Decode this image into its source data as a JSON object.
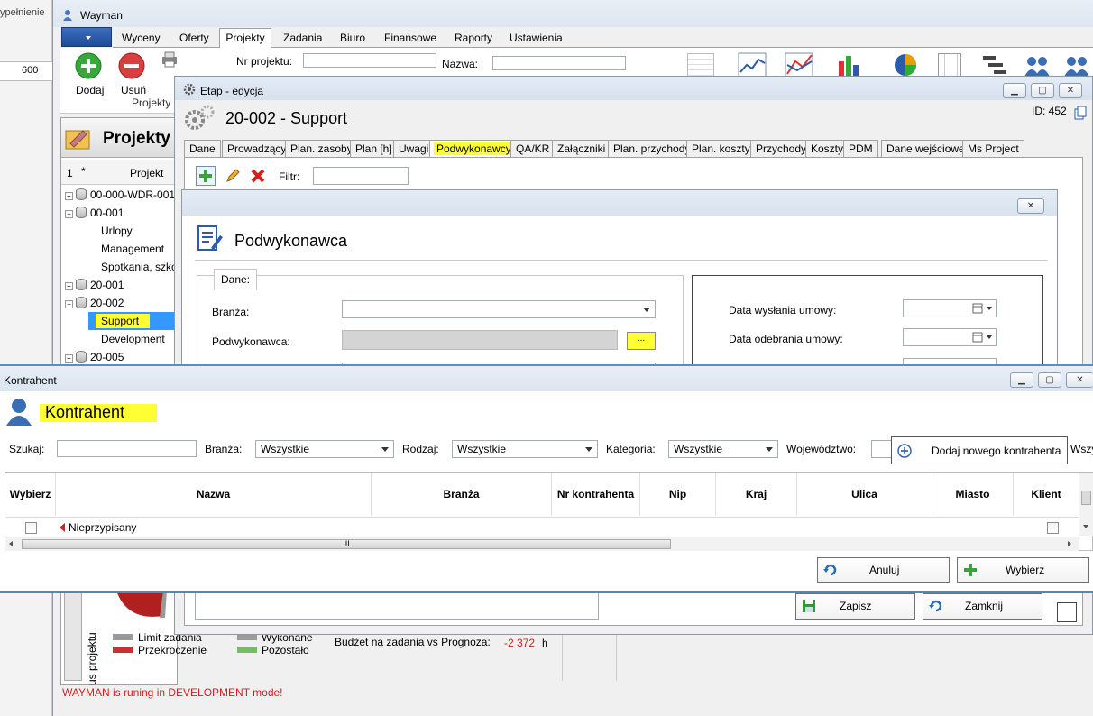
{
  "background_app": {
    "left_strip_text": "ypełnienie",
    "ruler_value": "600"
  },
  "main_window": {
    "title": "Wayman",
    "menu_tabs": [
      "Wyceny",
      "Oferty",
      "Projekty",
      "Zadania",
      "Biuro",
      "Finansowe",
      "Raporty",
      "Ustawienia"
    ],
    "active_tab": "Projekty",
    "ribbon": {
      "add_label": "Dodaj",
      "remove_label": "Usuń",
      "group_label": "Projekty",
      "project_number_label": "Nr projektu:",
      "name_label": "Nazwa:"
    },
    "panel_title": "Projekty",
    "tree_header": {
      "col1": "1",
      "col2": "*",
      "col3": "Projekt"
    },
    "tree_items": [
      {
        "label": "00-000-WDR-001",
        "level": 0,
        "expander": "+"
      },
      {
        "label": "00-001",
        "level": 0,
        "expander": "−"
      },
      {
        "label": "Urlopy",
        "level": 1
      },
      {
        "label": "Management",
        "level": 1
      },
      {
        "label": "Spotkania, szkol",
        "level": 1
      },
      {
        "label": "20-001",
        "level": 0,
        "expander": "+"
      },
      {
        "label": "20-002",
        "level": 0,
        "expander": "−"
      },
      {
        "label": "Support",
        "level": 1,
        "selected": true
      },
      {
        "label": "Development",
        "level": 1
      },
      {
        "label": "20-005",
        "level": 0,
        "expander": "+"
      }
    ],
    "side_vertical_label": "us projektu",
    "legend": {
      "limit": "Limit zadania",
      "over": "Przekroczenie",
      "done": "Wykonane",
      "left": "Pozostało"
    },
    "budget_label": "Budżet na zadania vs Prognoza:",
    "budget_value": "-2 372",
    "budget_unit": "h",
    "status_message": "WAYMAN is runing in DEVELOPMENT mode!"
  },
  "etap_window": {
    "title": "Etap - edycja",
    "heading": "20-002 - Support",
    "id_label": "ID: 452",
    "tabs": [
      "Dane",
      "Prowadzący",
      "Plan. zasoby",
      "Plan [h]",
      "Uwagi",
      "Podwykonawcy",
      "QA/KR",
      "Załączniki",
      "Plan. przychody",
      "Plan. koszty",
      "Przychody",
      "Koszty",
      "PDM",
      "Dane wejściowe",
      "Ms Project"
    ],
    "active_tab": "Podwykonawcy",
    "filter_label": "Filtr:",
    "save_label": "Zapisz",
    "close_label": "Zamknij"
  },
  "podwykonawca_dialog": {
    "title": "Podwykonawca",
    "group_label": "Dane:",
    "branza_label": "Branża:",
    "podwykonawca_label": "Podwykonawca:",
    "browse_label": "...",
    "date_sent_label": "Data wysłania umowy:",
    "date_received_label": "Data odebrania umowy:"
  },
  "kontrahent_window": {
    "window_title": "Kontrahent",
    "heading": "Kontrahent",
    "search_label": "Szukaj:",
    "branza_label": "Branża:",
    "branza_value": "Wszystkie",
    "rodzaj_label": "Rodzaj:",
    "rodzaj_value": "Wszystkie",
    "kategoria_label": "Kategoria:",
    "kategoria_value": "Wszystkie",
    "wojewodztwo_label": "Województwo:",
    "wojewodztwo_value": "Wszy",
    "add_contractor_label": "Dodaj nowego kontrahenta",
    "columns": [
      "Wybierz",
      "Nazwa",
      "Branża",
      "Nr kontrahenta",
      "Nip",
      "Kraj",
      "Ulica",
      "Miasto",
      "Klient"
    ],
    "rows": [
      {
        "nazwa": "Nieprzypisany"
      }
    ],
    "scroll_mark": "III",
    "cancel_label": "Anuluj",
    "choose_label": "Wybierz"
  },
  "colors": {
    "highlight": "#ffff33",
    "accent_blue": "#2b5ca8",
    "window_border": "#8a98a8",
    "danger_red": "#d42020",
    "legend_gray": "#9a9a9a",
    "legend_red": "#cc3030",
    "legend_green": "#70bf60"
  }
}
